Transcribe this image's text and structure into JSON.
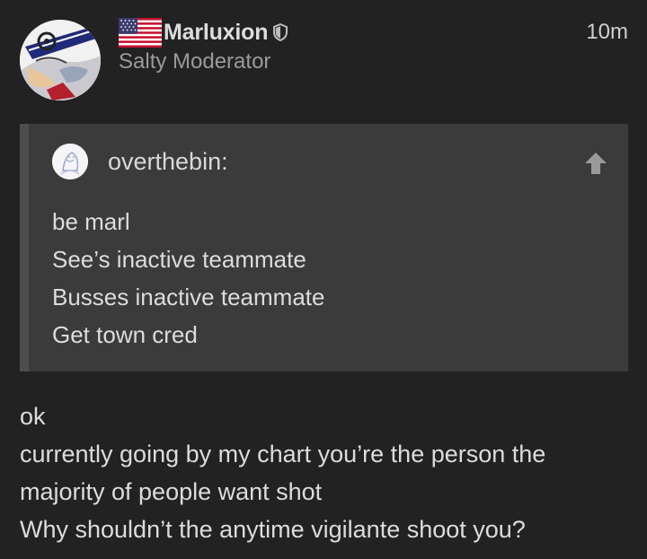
{
  "author": {
    "username": "Marluxion",
    "title": "Salty Moderator",
    "flag_icon": "us-flag-icon",
    "badge_icon": "moderator-shield-icon",
    "avatar": "user-avatar"
  },
  "timestamp": "10m",
  "quote": {
    "author": "overthebin:",
    "avatar": "quote-author-avatar",
    "jump_icon": "up-arrow-icon",
    "lines": [
      "be marl",
      "See’s inactive teammate",
      "Busses inactive teammate",
      "Get town cred"
    ]
  },
  "body": {
    "lines": [
      "ok",
      "currently going by my chart you’re the person the",
      "majority of people want shot",
      "Why shouldn’t the anytime vigilante shoot you?"
    ]
  },
  "colors": {
    "background": "#222222",
    "quote_background": "#3b3b3b",
    "quote_border": "#4d4d4d",
    "text": "#dddddd",
    "muted": "#9a9a9a"
  }
}
